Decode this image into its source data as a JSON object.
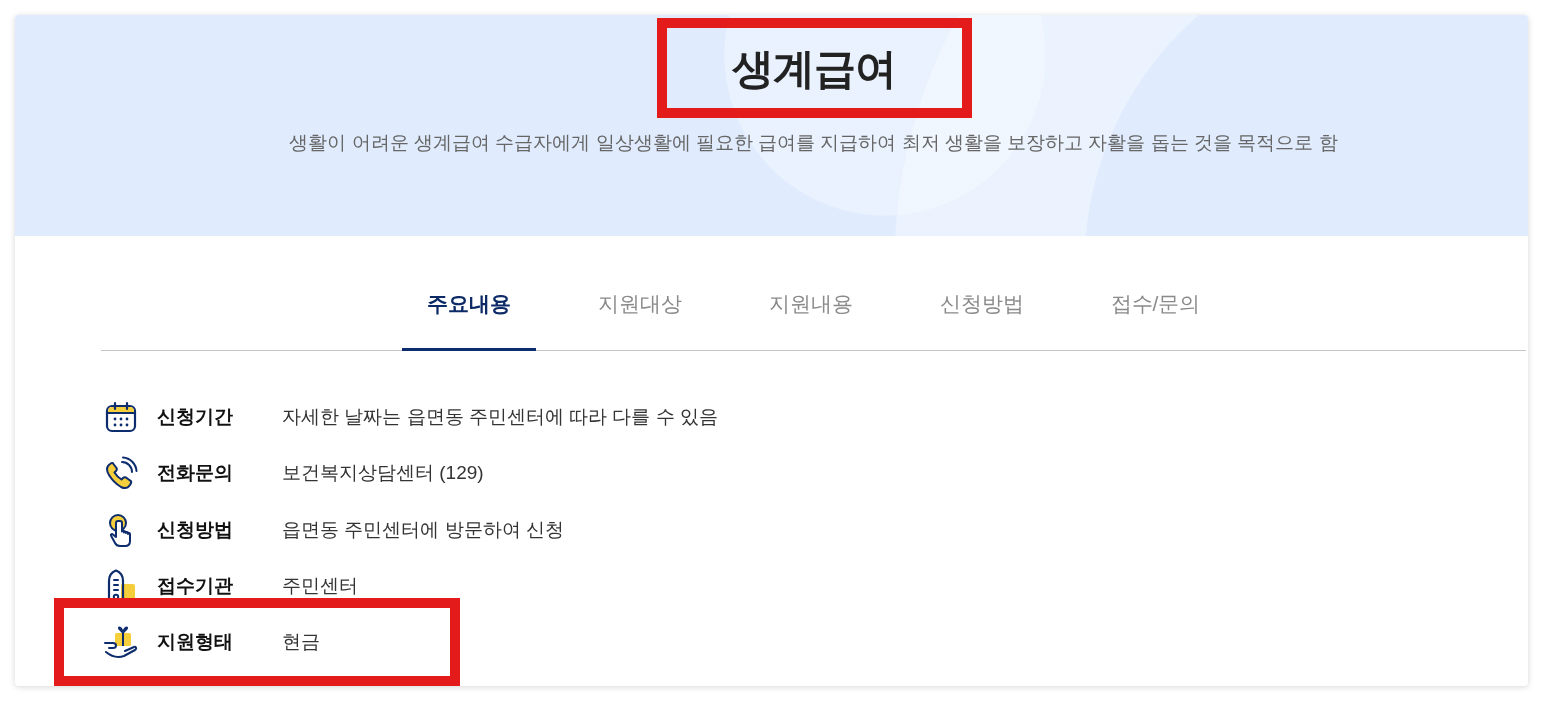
{
  "hero": {
    "title": {
      "text": "생계급여",
      "highlighted": true
    },
    "description": "생활이 어려운 생계급여 수급자에게 일상생활에 필요한 급여를 지급하여 최저 생활을 보장하고 자활을 돕는 것을 목적으로 함"
  },
  "tabs": [
    {
      "label": "주요내용",
      "selected": true
    },
    {
      "label": "지원대상",
      "selected": false
    },
    {
      "label": "지원내용",
      "selected": false
    },
    {
      "label": "신청방법",
      "selected": false
    },
    {
      "label": "접수/문의",
      "selected": false
    }
  ],
  "info_items": [
    {
      "label": "신청기간",
      "value": "자세한 날짜는 읍면동 주민센터에 따라 다를 수 있음",
      "highlighted": false
    },
    {
      "label": "전화문의",
      "value": "보건복지상담센터 (129)",
      "highlighted": false
    },
    {
      "label": "신청방법",
      "value": "읍면동 주민센터에 방문하여 신청",
      "highlighted": false
    },
    {
      "label": "접수기관",
      "value": "주민센터",
      "highlighted": false
    },
    {
      "label": "지원형태",
      "value": "현금",
      "highlighted": true
    }
  ]
}
